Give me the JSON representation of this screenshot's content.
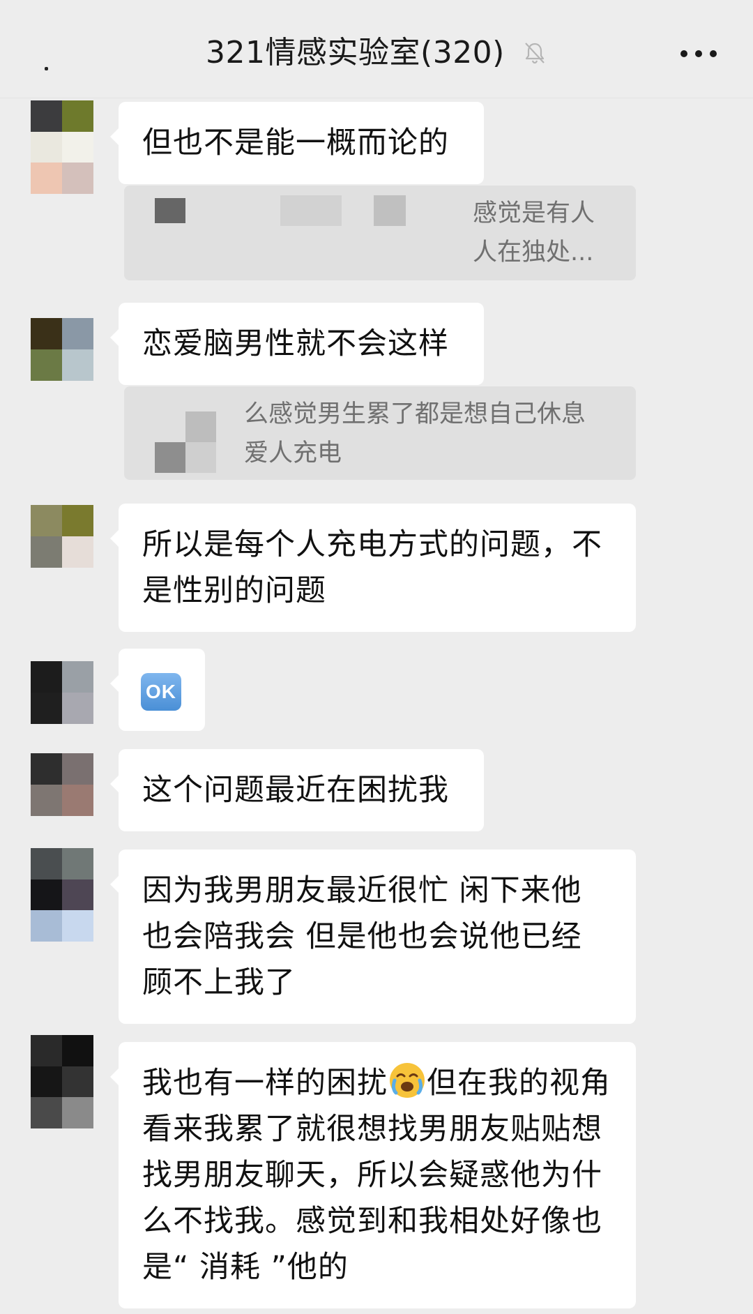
{
  "header": {
    "title": "321情感实验室(320)",
    "mute_icon": "bell-mute-icon",
    "more_icon": "more-dots-icon"
  },
  "messages": [
    {
      "text": "但也不是能一概而论的",
      "quote": {
        "line1": "感觉是有人",
        "line2": "人在独处..."
      }
    },
    {
      "text": "恋爱脑男性就不会这样",
      "quote": {
        "line1": "么感觉男生累了都是想自己休息",
        "line2": "爱人充电"
      }
    },
    {
      "text": "所以是每个人充电方式的问题，不是性别的问题"
    },
    {
      "text": "OK",
      "type": "emoji",
      "emoji_name": "ok-button-emoji"
    },
    {
      "text": "这个问题最近在困扰我"
    },
    {
      "text": "因为我男朋友最近很忙 闲下来他也会陪我会 但是他也会说他已经顾不上我了"
    },
    {
      "text_before": "我也有一样的困扰",
      "emoji_name": "crying-face-emoji",
      "text_after": "但在我的视角看来我累了就很想找男朋友贴贴想找男朋友聊天，所以会疑惑他为什么不找我。感觉到和我相处好像也是“ 消耗 ”他的"
    }
  ],
  "colors": {
    "background": "#ededed",
    "bubble": "#ffffff",
    "quote_background": "#e0e0e0",
    "quote_text": "#707070"
  }
}
